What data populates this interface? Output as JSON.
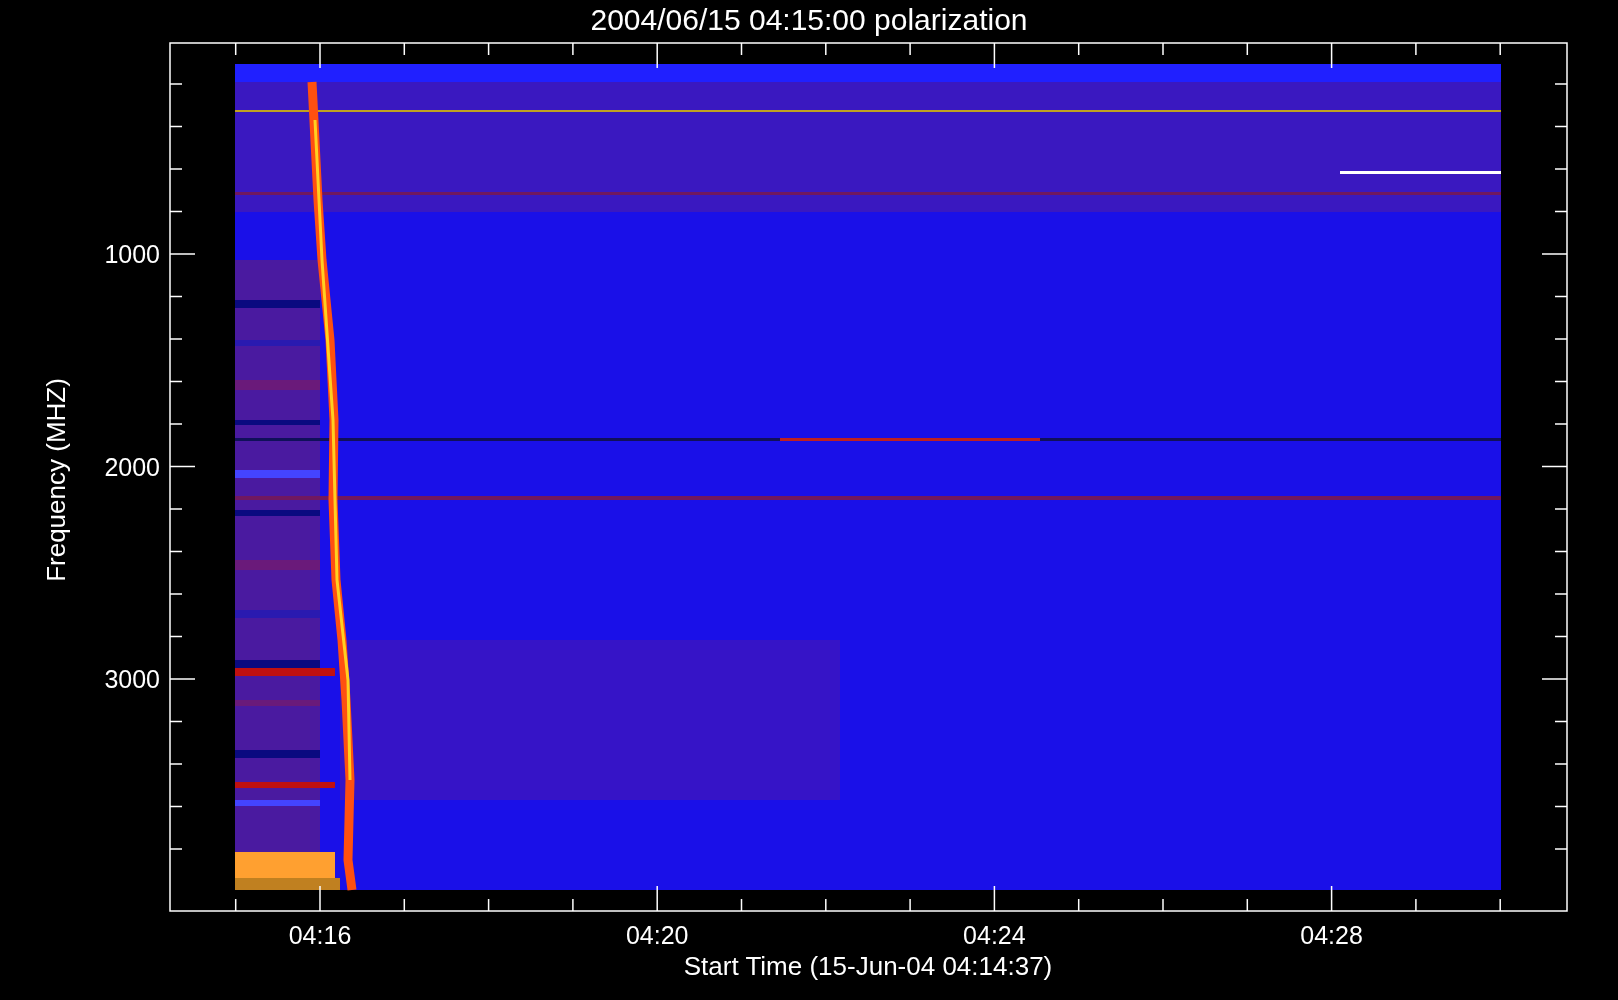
{
  "title": "2004/06/15 04:15:00 polarization",
  "y_axis": {
    "label": "Frequency (MHZ)",
    "tick_labels": [
      "1000",
      "2000",
      "3000"
    ]
  },
  "x_axis": {
    "label": "Start Time (15-Jun-04 04:14:37)",
    "tick_labels": [
      "04:16",
      "04:20",
      "04:24",
      "04:28"
    ]
  }
}
